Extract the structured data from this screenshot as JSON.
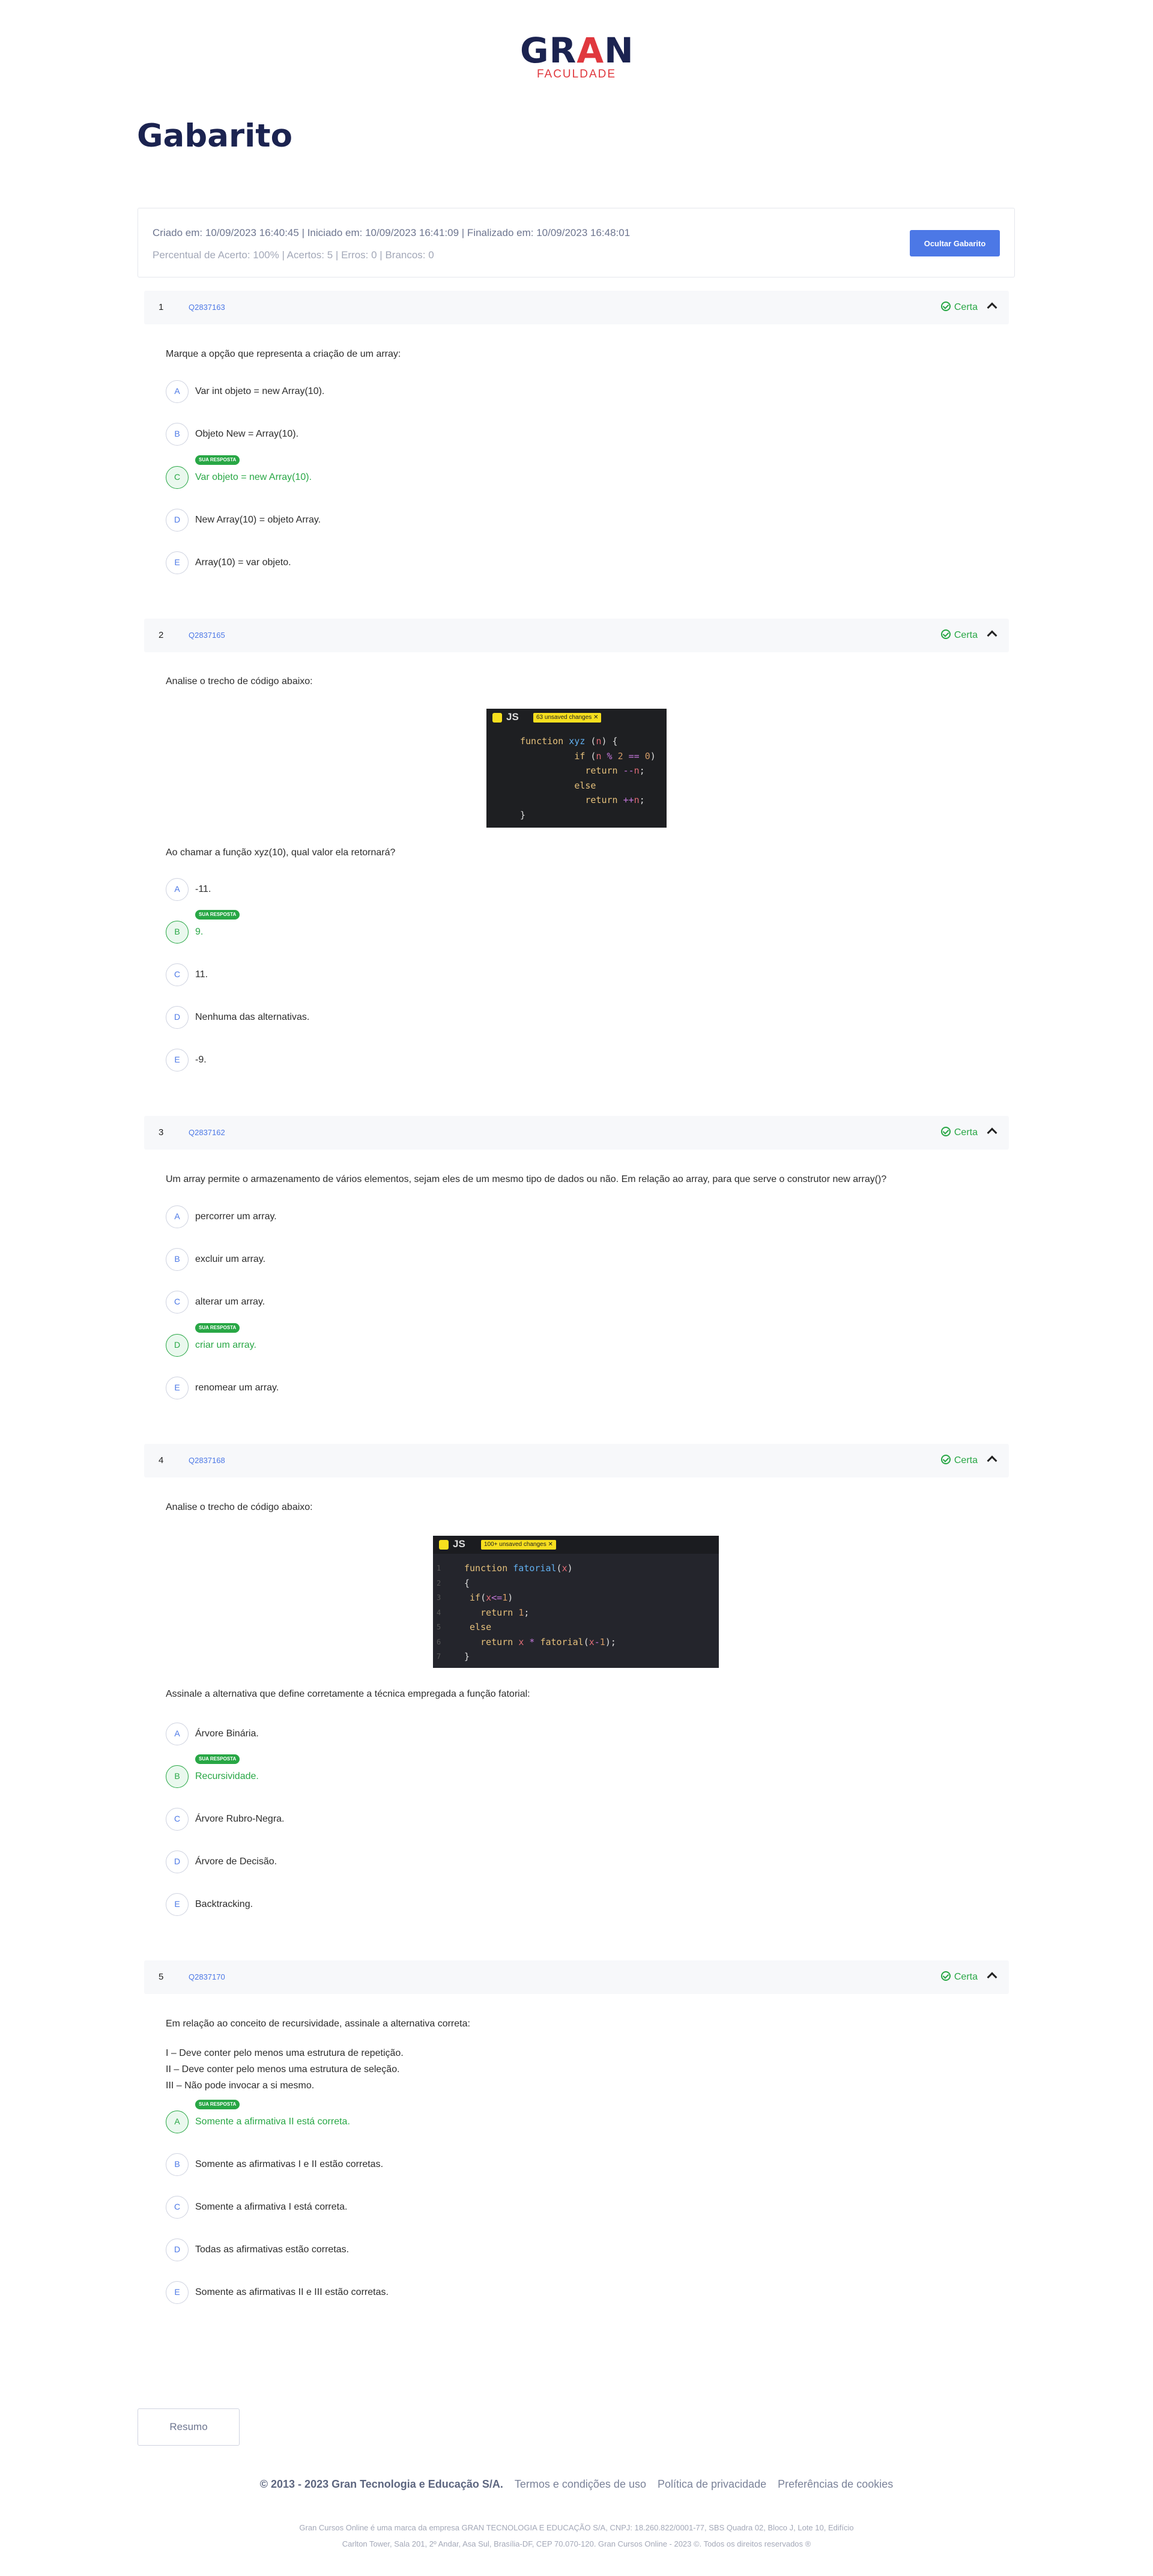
{
  "brand": {
    "name_a": "GR",
    "name_b": "A",
    "name_c": "N",
    "sub": "FACULDADE"
  },
  "page_title": "Gabarito",
  "summary": {
    "line1": "Criado em: 10/09/2023 16:40:45 | Iniciado em: 10/09/2023 16:41:09 | Finalizado em: 10/09/2023 16:48:01",
    "line2": "Percentual de Acerto: 100% | Acertos: 5 | Erros: 0 | Brancos: 0",
    "hide_button": "Ocultar Gabarito"
  },
  "badge_label": "SUA RESPOSTA",
  "questions": [
    {
      "num": "1",
      "code": "Q2837163",
      "status": "Certa",
      "statement": "Marque a opção que representa a criação de um array:",
      "options": [
        {
          "letter": "A",
          "text": "Var int objeto = new Array(10)."
        },
        {
          "letter": "B",
          "text": "Objeto New = Array(10)."
        },
        {
          "letter": "C",
          "text": "Var objeto = new Array(10)."
        },
        {
          "letter": "D",
          "text": "New Array(10) = objeto Array."
        },
        {
          "letter": "E",
          "text": "Array(10) = var objeto."
        }
      ]
    },
    {
      "num": "2",
      "code": "Q2837165",
      "status": "Certa",
      "statement": "Analise o trecho de código abaixo:",
      "code_tag": "63 unsaved changes ✕",
      "question": "Ao chamar a função xyz(10), qual valor ela retornará?",
      "options": [
        {
          "letter": "A",
          "text": "-11."
        },
        {
          "letter": "B",
          "text": "9."
        },
        {
          "letter": "C",
          "text": "11."
        },
        {
          "letter": "D",
          "text": "Nenhuma das alternativas."
        },
        {
          "letter": "E",
          "text": "-9."
        }
      ]
    },
    {
      "num": "3",
      "code": "Q2837162",
      "status": "Certa",
      "statement": "Um array permite o armazenamento de vários elementos, sejam eles de um mesmo tipo de dados ou não. Em relação ao array, para que serve o construtor new array()?",
      "options": [
        {
          "letter": "A",
          "text": "percorrer um array."
        },
        {
          "letter": "B",
          "text": "excluir um array."
        },
        {
          "letter": "C",
          "text": "alterar um array."
        },
        {
          "letter": "D",
          "text": "criar um array."
        },
        {
          "letter": "E",
          "text": "renomear um array."
        }
      ]
    },
    {
      "num": "4",
      "code": "Q2837168",
      "status": "Certa",
      "statement": "Analise o trecho de código abaixo:",
      "code_tag": "100+ unsaved changes ✕",
      "question": "Assinale a alternativa que define corretamente a técnica empregada a função fatorial:",
      "options": [
        {
          "letter": "A",
          "text": "Árvore Binária."
        },
        {
          "letter": "B",
          "text": "Recursividade."
        },
        {
          "letter": "C",
          "text": "Árvore Rubro-Negra."
        },
        {
          "letter": "D",
          "text": "Árvore de Decisão."
        },
        {
          "letter": "E",
          "text": "Backtracking."
        }
      ]
    },
    {
      "num": "5",
      "code": "Q2837170",
      "status": "Certa",
      "statement": "Em relação ao conceito de recursividade, assinale a alternativa correta:",
      "item1": "I – Deve conter pelo menos uma estrutura de repetição.",
      "item2": "II – Deve conter pelo menos uma estrutura de seleção.",
      "item3": "III – Não pode invocar a si mesmo.",
      "options": [
        {
          "letter": "A",
          "text": "Somente a afirmativa II está correta."
        },
        {
          "letter": "B",
          "text": "Somente as afirmativas I e II estão corretas."
        },
        {
          "letter": "C",
          "text": "Somente a afirmativa I está correta."
        },
        {
          "letter": "D",
          "text": "Todas as afirmativas estão corretas."
        },
        {
          "letter": "E",
          "text": "Somente as afirmativas II e III estão corretas."
        }
      ]
    }
  ],
  "summary_button": "Resumo",
  "footer": {
    "copyright": "© 2013 - 2023 Gran Tecnologia e Educação S/A.",
    "terms": "Termos e condições de uso",
    "privacy": "Política de privacidade",
    "cookies": "Preferências de cookies",
    "legal1": "Gran Cursos Online é uma marca da empresa GRAN TECNOLOGIA E EDUCAÇÃO S/A, CNPJ: 18.260.822/0001-77, SBS Quadra 02, Bloco J, Lote 10, Edifício",
    "legal2": "Carlton Tower, Sala 201, 2º Andar, Asa Sul, Brasília-DF, CEP 70.070-120. Gran Cursos Online - 2023 ©. Todos os direitos reservados ®"
  },
  "colors": {
    "accent": "#4c78e6",
    "correct": "#28a745",
    "brand_navy": "#1b2350",
    "brand_red": "#e0383e"
  }
}
